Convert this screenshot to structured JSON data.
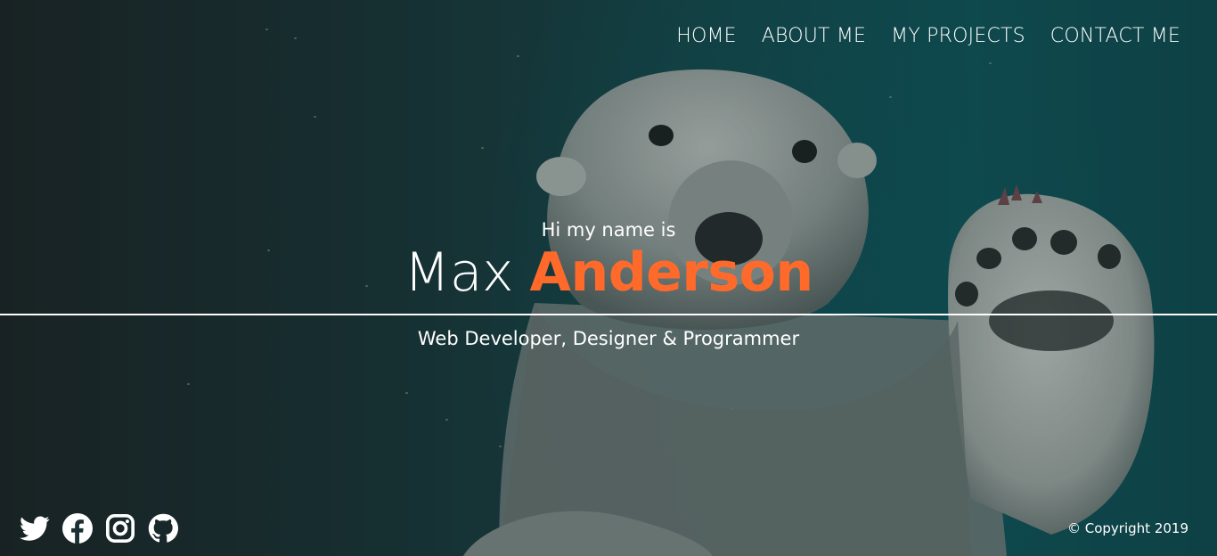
{
  "nav": {
    "items": [
      {
        "label": "HOME"
      },
      {
        "label": "ABOUT ME"
      },
      {
        "label": "MY PROJECTS"
      },
      {
        "label": "CONTACT ME"
      }
    ]
  },
  "hero": {
    "intro": "Hi my name is",
    "first_name": "Max",
    "last_name": "Anderson",
    "tagline": "Web Developer, Designer & Programmer",
    "accent_color": "#ff6a2b",
    "background_image": "polar-bear-underwater"
  },
  "social": {
    "icons": [
      "twitter-icon",
      "facebook-icon",
      "instagram-icon",
      "github-icon"
    ]
  },
  "footer": {
    "copyright": "© Copyright 2019"
  }
}
